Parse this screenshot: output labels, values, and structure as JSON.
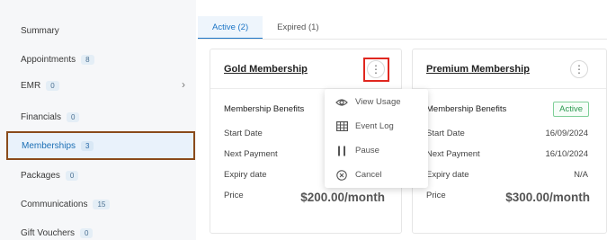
{
  "sidebar": {
    "items": [
      {
        "label": "Summary",
        "badge": null
      },
      {
        "label": "Appointments",
        "badge": "8"
      },
      {
        "label": "EMR",
        "badge": "0"
      },
      {
        "label": "Financials",
        "badge": "0"
      },
      {
        "label": "Memberships",
        "badge": "3"
      },
      {
        "label": "Packages",
        "badge": "0"
      },
      {
        "label": "Communications",
        "badge": "15"
      },
      {
        "label": "Gift Vouchers",
        "badge": "0"
      }
    ]
  },
  "tabs": [
    {
      "label": "Active (2)"
    },
    {
      "label": "Expired (1)"
    }
  ],
  "cards": {
    "gold": {
      "title": "Gold Membership",
      "benefits": "Membership Benefits",
      "start_label": "Start Date",
      "next_label": "Next Payment",
      "expiry_label": "Expiry date",
      "price_label": "Price",
      "price": "$200.00/month"
    },
    "premium": {
      "title": "Premium Membership",
      "benefits": "Membership Benefits",
      "status": "Active",
      "start_label": "Start Date",
      "start_value": "16/09/2024",
      "next_label": "Next Payment",
      "next_value": "16/10/2024",
      "expiry_label": "Expiry date",
      "expiry_value": "N/A",
      "price_label": "Price",
      "price": "$300.00/month"
    }
  },
  "menu": {
    "items": [
      {
        "label": "View Usage",
        "icon": "eye-icon"
      },
      {
        "label": "Event Log",
        "icon": "table-icon"
      },
      {
        "label": "Pause",
        "icon": "pause-icon"
      },
      {
        "label": "Cancel",
        "icon": "cancel-circle-icon"
      }
    ]
  },
  "colors": {
    "accent": "#1b74c5",
    "active_status": "#2e9a52",
    "highlight_red": "#e0271f",
    "selected_border": "#8a4b1b"
  }
}
